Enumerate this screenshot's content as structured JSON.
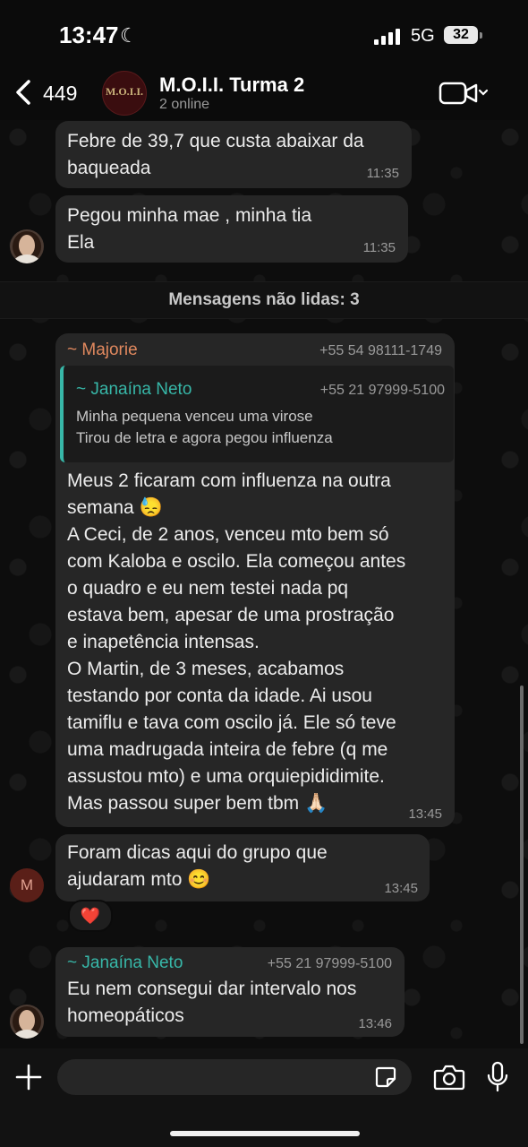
{
  "status_bar": {
    "time": "13:47",
    "network": "5G",
    "battery": "32"
  },
  "header": {
    "back_count": "449",
    "group_avatar_text": "M.O.I.I.",
    "group_name": "M.O.I.I. Turma 2",
    "online": "2 online"
  },
  "messages": [
    {
      "text": "Febre de 39,7 que custa abaixar da\nbaqueada",
      "time": "11:35"
    },
    {
      "text": "Pegou minha mae , minha tia\nEla",
      "time": "11:35"
    }
  ],
  "unread_label": "Mensagens não lidas: 3",
  "majorie_msg": {
    "sender": "~ Majorie",
    "phone": "+55 54 98111-1749",
    "quote": {
      "sender": "~ Janaína Neto",
      "phone": "+55 21 97999-5100",
      "text": "Minha pequena venceu uma virose\nTirou de letra e agora pegou influenza"
    },
    "text": "Meus 2 ficaram com influenza na outra\nsemana 😓\nA Ceci, de 2 anos, venceu mto bem só\ncom Kaloba e oscilo. Ela começou antes\no quadro e eu nem testei nada pq\nestava bem, apesar de uma prostração\ne inapetência intensas.\nO Martin, de 3 meses, acabamos\ntestando por conta da idade. Ai usou\ntamiflu e tava com oscilo já. Ele só teve\numa madrugada inteira de febre (q me\nassustou mto) e uma orquiepididimite.\nMas passou super bem tbm 🙏🏻",
    "time": "13:45"
  },
  "m_msg": {
    "avatar_letter": "M",
    "text": "Foram dicas aqui do grupo que\najudaram mto 😊",
    "time": "13:45",
    "reaction": "❤️"
  },
  "janaina_msg": {
    "sender": "~ Janaína Neto",
    "phone": "+55 21 97999-5100",
    "text": "Eu nem consegui dar intervalo nos\nhomeopáticos",
    "time": "13:46"
  },
  "colors": {
    "majorie": "#e0885e",
    "janaina": "#37b7a8",
    "bubble": "#262626",
    "background": "#0b0b0b"
  },
  "icons": [
    "moon-icon",
    "signal-icon",
    "back-chevron-icon",
    "video-call-icon",
    "plus-icon",
    "sticker-icon",
    "camera-icon",
    "mic-icon"
  ]
}
